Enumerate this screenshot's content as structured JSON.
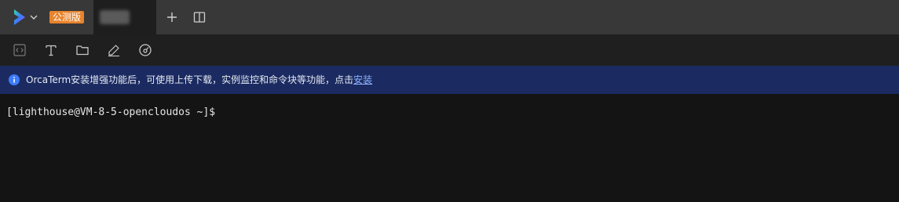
{
  "tabbar": {
    "beta_badge": "公测版"
  },
  "icons": {
    "logo": "orcaterm-logo-icon",
    "dropdown": "chevron-down-icon",
    "add_tab": "plus-icon",
    "split": "split-view-icon",
    "toolbar": [
      "code-icon",
      "text-icon",
      "folder-icon",
      "pen-icon",
      "gauge-icon"
    ],
    "notice": "info-icon"
  },
  "notice": {
    "message": "OrcaTerm安装增强功能后，可使用上传下载，实例监控和命令块等功能，点击",
    "link_label": "安装"
  },
  "terminal": {
    "prompt": "[lighthouse@VM-8-5-opencloudos ~]$"
  },
  "colors": {
    "tabbar_bg": "#383838",
    "toolbar_bg": "#1f1f1f",
    "notice_bg": "#1b2b61",
    "terminal_bg": "#141414",
    "beta_badge_bg": "#e8842c",
    "info_icon": "#3d7bff",
    "link": "#8fb2ff"
  }
}
